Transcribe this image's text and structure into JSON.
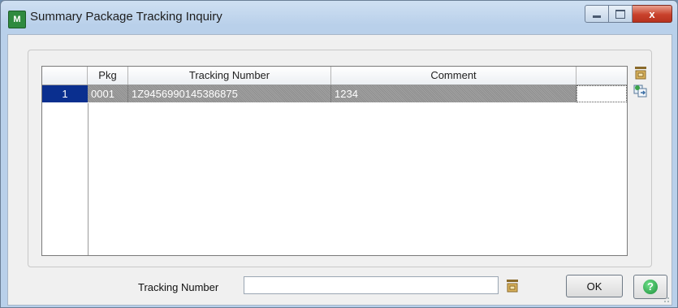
{
  "window": {
    "title": "Summary Package Tracking Inquiry",
    "app_icon_text": "M",
    "close_glyph": "x"
  },
  "grid": {
    "columns": [
      "Pkg",
      "Tracking Number",
      "Comment"
    ],
    "rows": [
      {
        "num": "1",
        "pkg": "0001",
        "tracking": "1Z9456990145386875",
        "comment": "1234"
      }
    ]
  },
  "footer": {
    "tracking_label": "Tracking Number",
    "tracking_value": "",
    "ok_label": "OK",
    "help_text": "?"
  },
  "icons": {
    "lookup": "lookup-icon",
    "copy": "copy-icon",
    "help": "help-icon"
  },
  "colors": {
    "row_number_bg": "#0a2f8f",
    "selection_bg": "#999999",
    "help_green": "#1c8f3a"
  }
}
